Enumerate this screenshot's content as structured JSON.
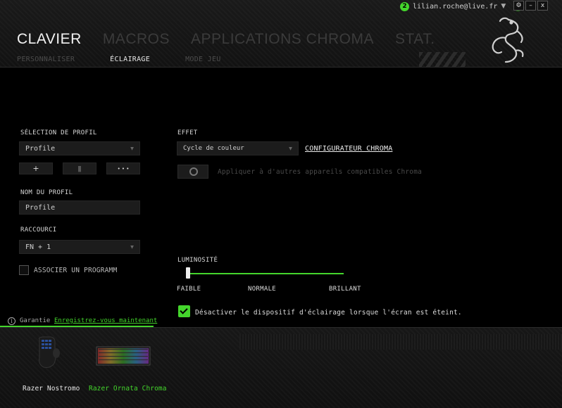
{
  "window": {
    "notifications_count": "2",
    "user_email": "lilian.roche@live.fr",
    "settings_label": "⚙",
    "minimize_label": "–",
    "close_label": "x"
  },
  "main_tabs": [
    {
      "label": "CLAVIER",
      "active": true
    },
    {
      "label": "MACROS",
      "active": false
    },
    {
      "label": "APPLICATIONS CHROMA",
      "active": false
    },
    {
      "label": "STAT.",
      "active": false
    }
  ],
  "sub_tabs": [
    {
      "label": "PERSONNALISER",
      "active": false
    },
    {
      "label": "ÉCLAIRAGE",
      "active": true
    },
    {
      "label": "MODE JEU",
      "active": false
    }
  ],
  "profile": {
    "section_label": "SÉLECTION DE PROFIL",
    "selected": "Profile",
    "add_label": "+",
    "delete_label": "▮",
    "more_label": "• • •",
    "name_label": "NOM DU PROFIL",
    "name_value": "Profile",
    "shortcut_label": "RACCOURCI",
    "shortcut_value": "FN + 1",
    "link_program_label": "ASSOCIER UN PROGRAMM"
  },
  "effect": {
    "section_label": "EFFET",
    "selected": "Cycle de couleur",
    "chroma_link": "CONFIGURATEUR CHROMA",
    "apply_label": "Appliquer à d'autres appareils compatibles Chroma"
  },
  "brightness": {
    "section_label": "LUMINOSITÉ",
    "low": "FAIBLE",
    "mid": "NORMALE",
    "high": "BRILLANT",
    "level": 0
  },
  "lighting_off": {
    "checked": true,
    "label": "Désactiver le dispositif d'éclairage lorsque l'écran est éteint."
  },
  "warranty": {
    "icon_glyph": "i",
    "label": "Garantie",
    "link": "Enregistrez-vous maintenant"
  },
  "devices": [
    {
      "name": "Razer Nostromo",
      "active": false
    },
    {
      "name": "Razer Ornata Chroma",
      "active": true
    }
  ],
  "colors": {
    "accent": "#44d62c",
    "background": "#000000"
  }
}
